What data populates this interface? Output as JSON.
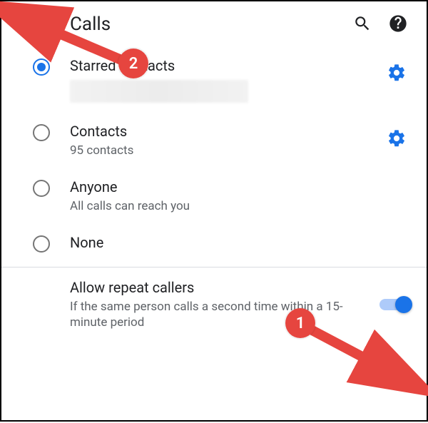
{
  "header": {
    "title": "Calls"
  },
  "options": [
    {
      "id": "starred",
      "title": "Starred contacts",
      "sub_redacted": true,
      "selected": true,
      "has_gear": true
    },
    {
      "id": "contacts",
      "title": "Contacts",
      "sub": "95 contacts",
      "selected": false,
      "has_gear": true
    },
    {
      "id": "anyone",
      "title": "Anyone",
      "sub": "All calls can reach you",
      "selected": false,
      "has_gear": false
    },
    {
      "id": "none",
      "title": "None",
      "selected": false,
      "has_gear": false
    }
  ],
  "repeat": {
    "title": "Allow repeat callers",
    "sub": "If the same person calls a second time within a 15-minute period",
    "enabled": true
  },
  "annotations": {
    "badge1": "1",
    "badge2": "2"
  },
  "colors": {
    "accent": "#1a73e8",
    "annotation": "#e6453f"
  }
}
